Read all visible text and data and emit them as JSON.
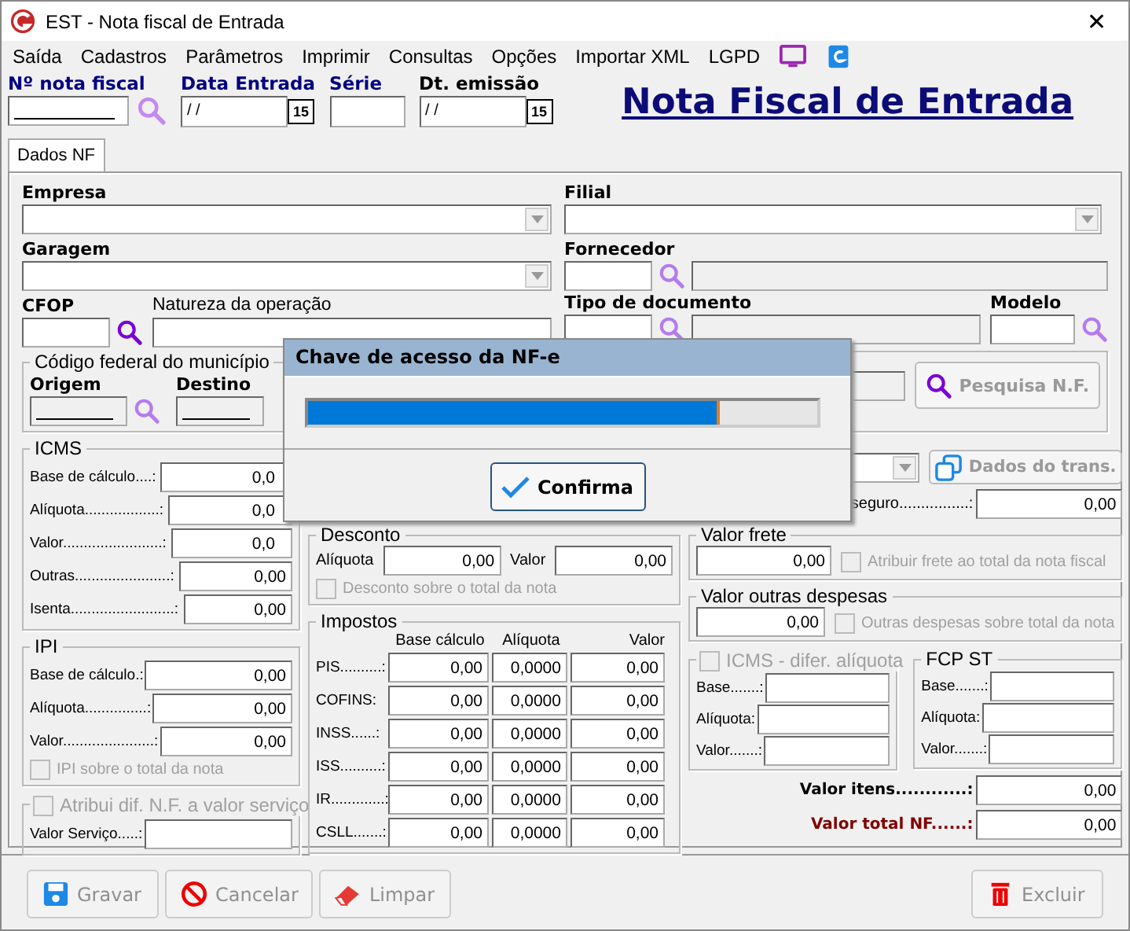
{
  "window": {
    "title": "EST - Nota fiscal de Entrada",
    "close": "✕"
  },
  "menu": [
    "Saída",
    "Cadastros",
    "Parâmetros",
    "Imprimir",
    "Consultas",
    "Opções",
    "Importar XML",
    "LGPD"
  ],
  "header": {
    "fields": [
      {
        "label": "Nº nota fiscal",
        "kind": "lookup"
      },
      {
        "label": "Data Entrada",
        "kind": "date",
        "value": "/ /",
        "picker": "15"
      },
      {
        "label": "Série",
        "kind": "text"
      },
      {
        "label": "Dt. emissão",
        "kind": "date",
        "value": "/ /",
        "picker": "15"
      }
    ],
    "title": "Nota Fiscal de Entrada"
  },
  "tabs": [
    {
      "label": "Dados NF",
      "selected": true
    }
  ],
  "labels": {
    "empresa": "Empresa",
    "filial": "Filial",
    "garagem": "Garagem",
    "fornecedor": "Fornecedor",
    "cfop": "CFOP",
    "natureza": "Natureza da operação",
    "tipo_documento": "Tipo de documento",
    "modelo": "Modelo"
  },
  "municipio": {
    "title": "Código federal do município",
    "origem": "Origem",
    "destino": "Destino"
  },
  "pesquisa_button": {
    "label": "Pesquisa N.F.",
    "disabled": true
  },
  "icms": {
    "title": "ICMS",
    "rows": [
      {
        "label": "Base de cálculo....:",
        "value": "0,0"
      },
      {
        "label": "Alíquota..................:",
        "value": "0,0"
      },
      {
        "label": "Valor........................:",
        "value": "0,0"
      },
      {
        "label": "Outras.......................:",
        "value": "0,00"
      },
      {
        "label": "Isenta.........................:",
        "value": "0,00"
      }
    ]
  },
  "ipi": {
    "title": "IPI",
    "rows": [
      {
        "label": "Base de cálculo.:",
        "value": "0,00"
      },
      {
        "label": "Alíquota...............:",
        "value": "0,00"
      },
      {
        "label": "Valor......................:",
        "value": "0,00"
      }
    ],
    "checkbox": {
      "label": "IPI sobre o total da nota",
      "checked": false,
      "disabled": true
    }
  },
  "servico": {
    "checkbox": {
      "label": "Atribui dif. N.F. a valor serviço",
      "checked": false,
      "disabled": true
    },
    "label": "Valor Serviço.....:"
  },
  "desconto": {
    "title": "Desconto",
    "aliquota_label": "Alíquota",
    "aliquota": "0,00",
    "valor_label": "Valor",
    "valor": "0,00",
    "checkbox": {
      "label": "Desconto sobre o total da nota",
      "checked": false,
      "disabled": true
    }
  },
  "impostos": {
    "title": "Impostos",
    "columns": [
      "Base cálculo",
      "Alíquota",
      "Valor"
    ],
    "rows": [
      {
        "label": "PIS..........:",
        "base": "0,00",
        "aliquota": "0,0000",
        "valor": "0,00"
      },
      {
        "label": "COFINS:",
        "base": "0,00",
        "aliquota": "0,0000",
        "valor": "0,00"
      },
      {
        "label": "INSS......:",
        "base": "0,00",
        "aliquota": "0,0000",
        "valor": "0,00"
      },
      {
        "label": "ISS..........:",
        "base": "0,00",
        "aliquota": "0,0000",
        "valor": "0,00"
      },
      {
        "label": "IR.............:",
        "base": "0,00",
        "aliquota": "0,0000",
        "valor": "0,00"
      },
      {
        "label": "CSLL.......:",
        "base": "0,00",
        "aliquota": "0,0000",
        "valor": "0,00"
      }
    ]
  },
  "transporte": {
    "button": {
      "label": "Dados do trans.",
      "disabled": true
    },
    "seguro_label": "seguro................:",
    "seguro": "0,00"
  },
  "frete": {
    "title": "Valor frete",
    "value": "0,00",
    "checkbox": {
      "label": "Atribuir frete ao total da nota fiscal",
      "checked": false,
      "disabled": true
    }
  },
  "outras": {
    "title": "Valor outras despesas",
    "value": "0,00",
    "checkbox": {
      "label": "Outras despesas sobre total da nota",
      "checked": false,
      "disabled": true
    }
  },
  "difer": {
    "checkbox": {
      "label": "ICMS - difer. alíquota",
      "checked": false,
      "disabled": true
    },
    "rows": [
      "Base.......:",
      "Alíquota:",
      "Valor.......:"
    ]
  },
  "fcp": {
    "title": "FCP ST",
    "rows": [
      "Base.......:",
      "Alíquota:",
      "Valor.......:"
    ]
  },
  "totals": [
    {
      "label": "Valor itens............:",
      "value": "0,00",
      "kind": "normal"
    },
    {
      "label": "Valor total NF......:",
      "value": "0,00",
      "kind": "highlight"
    }
  ],
  "dialog": {
    "title": "Chave de acesso da NF-e",
    "level": 0.81,
    "button": "Confirma"
  },
  "footer": [
    {
      "label": "Gravar",
      "kind": "save",
      "disabled": true
    },
    {
      "label": "Cancelar",
      "kind": "cancel",
      "disabled": true
    },
    {
      "label": "Limpar",
      "kind": "clear",
      "disabled": true
    },
    {
      "label": "Excluir",
      "kind": "delete",
      "disabled": true
    }
  ]
}
